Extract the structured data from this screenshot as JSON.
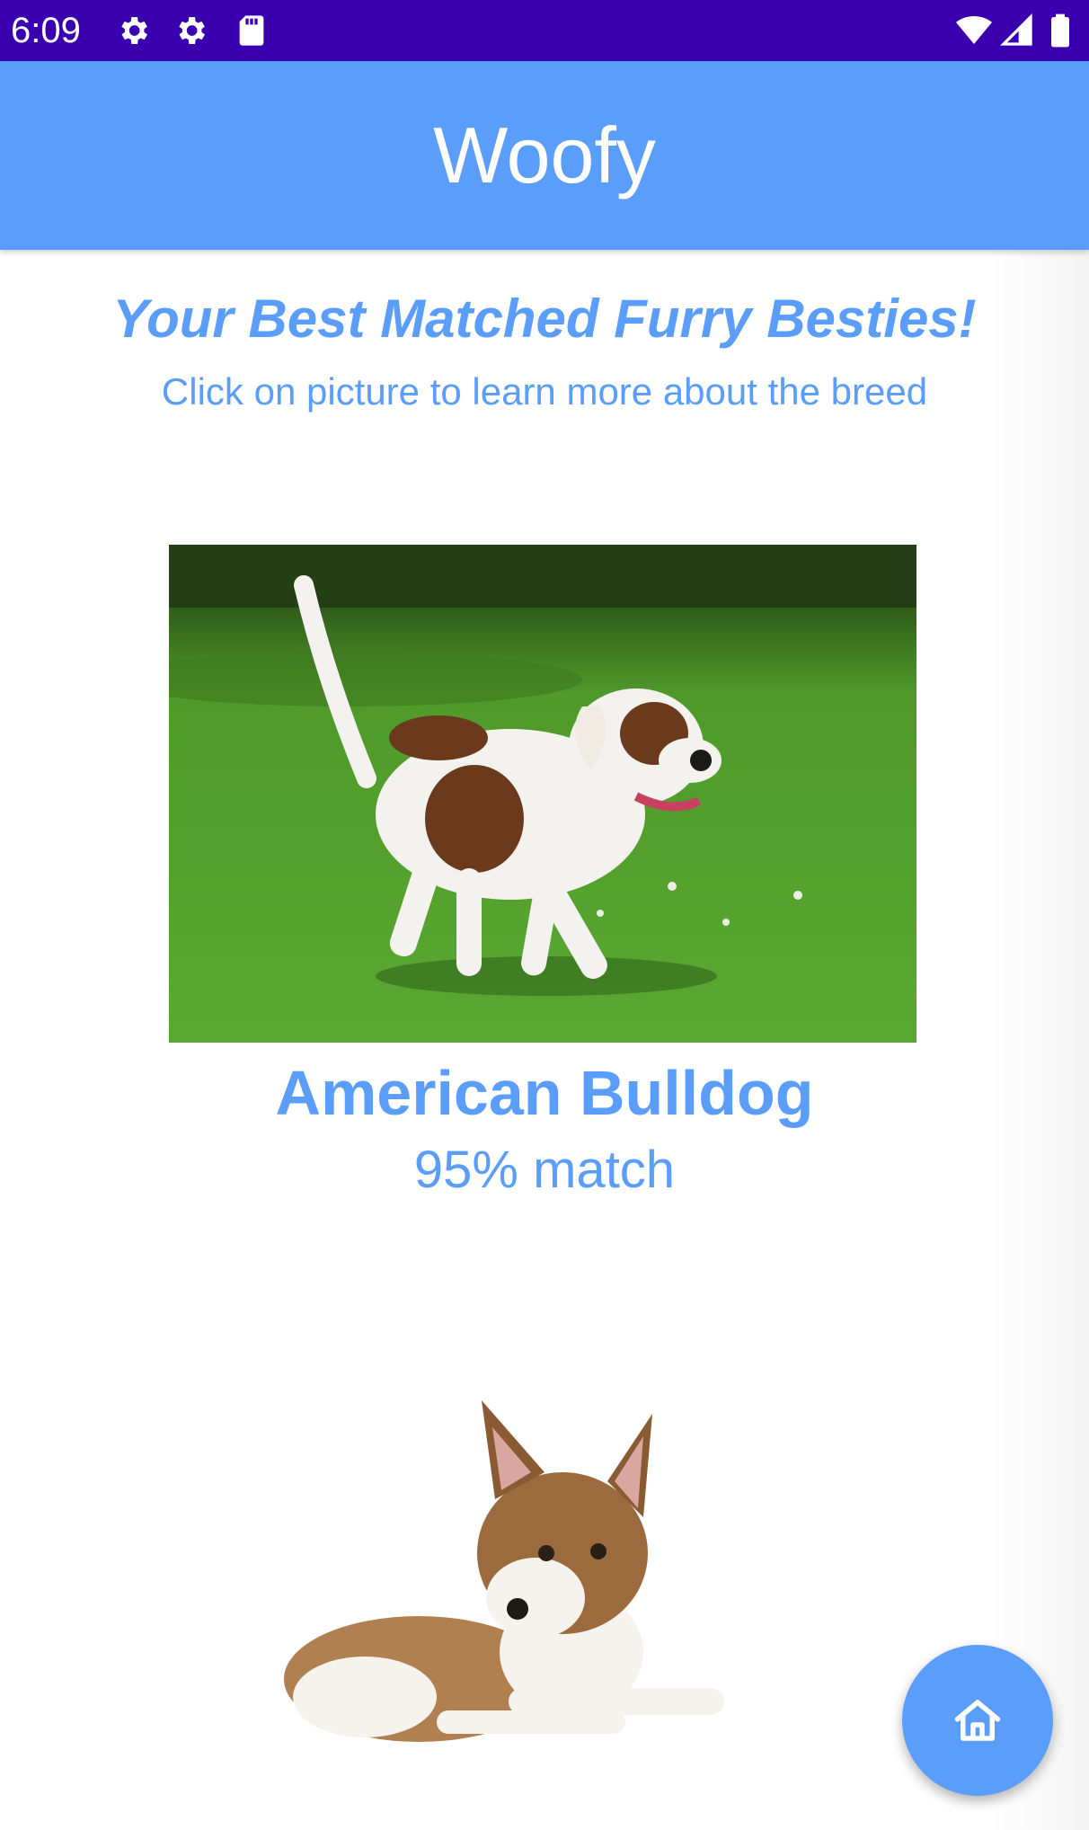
{
  "status_bar": {
    "time": "6:09",
    "icons": [
      "settings-icon",
      "settings-icon",
      "sd-card-icon",
      "wifi-icon",
      "signal-icon",
      "battery-icon"
    ]
  },
  "app_bar": {
    "title": "Woofy"
  },
  "header": {
    "headline": "Your Best Matched Furry Besties!",
    "subtitle": "Click on picture to learn more about the breed"
  },
  "matches": [
    {
      "breed": "American Bulldog",
      "match": "95% match",
      "photo_icon": "american-bulldog-photo"
    },
    {
      "photo_icon": "basenji-puppy-photo"
    }
  ],
  "fab": {
    "icon": "home-icon"
  },
  "colors": {
    "status_bar": "#3a00b0",
    "primary": "#5a9dfa",
    "background": "#ffffff"
  }
}
